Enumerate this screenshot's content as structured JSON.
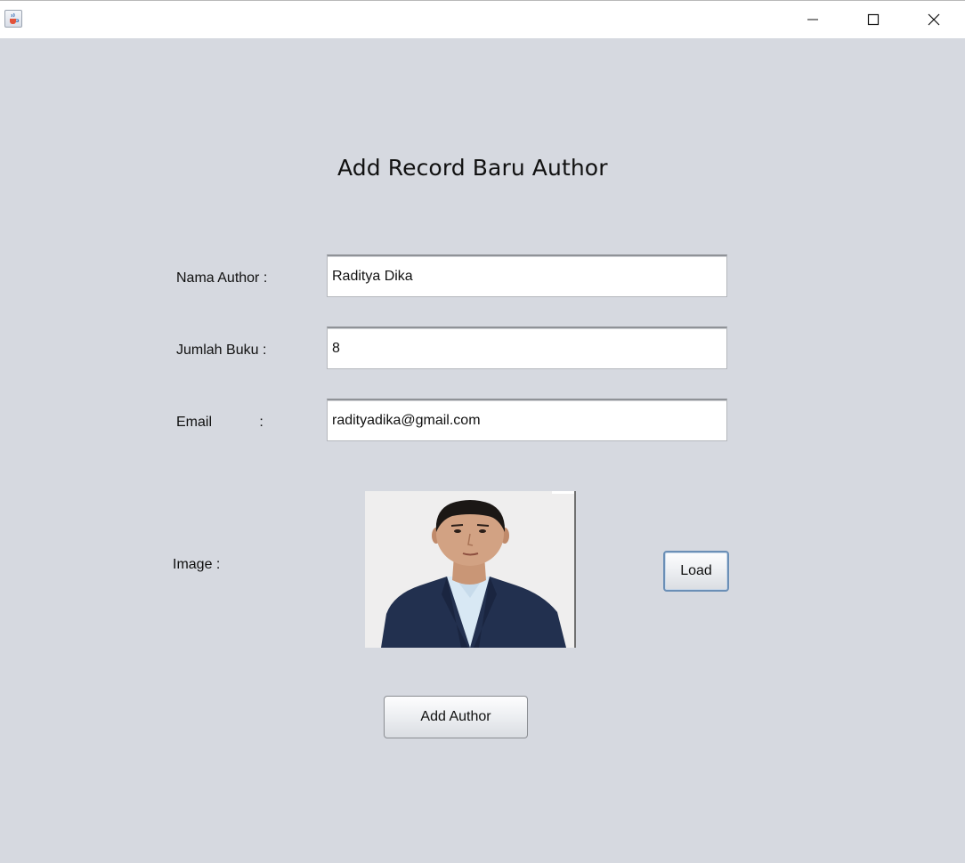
{
  "window": {
    "app_icon": "java-cup-icon",
    "controls": {
      "minimize_icon": "minimize-icon",
      "maximize_icon": "maximize-icon",
      "close_icon": "close-icon"
    }
  },
  "form": {
    "title": "Add Record Baru Author",
    "fields": {
      "nama_author": {
        "label": "Nama Author :",
        "value": "Raditya Dika"
      },
      "jumlah_buku": {
        "label": "Jumlah Buku :",
        "value": "8"
      },
      "email": {
        "label": "Email            :",
        "value": "radityadika@gmail.com"
      }
    },
    "image": {
      "label": "Image :"
    },
    "buttons": {
      "load": "Load",
      "add_author": "Add Author"
    }
  },
  "colors": {
    "background": "#d6d9e0",
    "titlebar": "#ffffff",
    "field_background": "#ffffff",
    "load_button_focus_border": "#6b8fb6",
    "suit_navy": "#22304f",
    "shirt_light_blue": "#d8e8f4",
    "photo_background": "#efeeee"
  }
}
